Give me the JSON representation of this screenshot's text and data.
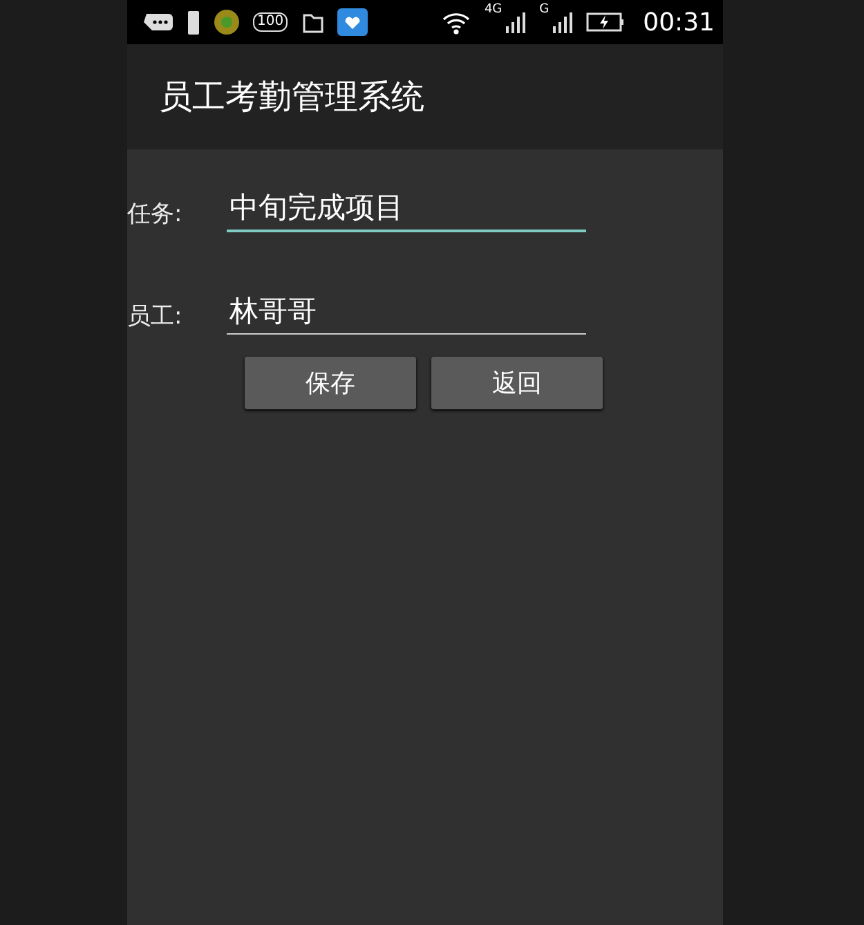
{
  "status_bar": {
    "battery_label": "100",
    "network_1": "4G",
    "network_2": "G",
    "time": "00:31"
  },
  "app_bar": {
    "title": "员工考勤管理系统"
  },
  "fields": [
    {
      "label": "任务:",
      "value": "中旬完成项目",
      "focused": true
    },
    {
      "label": "员工:",
      "value": "林哥哥",
      "focused": false
    }
  ],
  "buttons": [
    "保存",
    "返回"
  ]
}
